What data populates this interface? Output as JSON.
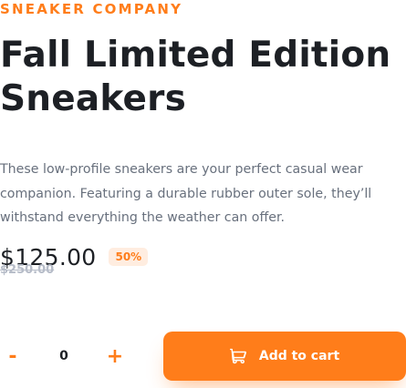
{
  "product": {
    "company": "SNEAKER COMPANY",
    "title": "Fall Limited Edition Sneakers",
    "description": "These low-profile sneakers are your perfect casual wear companion. Featuring a durable rubber outer sole, they’ll withstand everything the weather can offer.",
    "price": "$125.00",
    "discount": "50%",
    "original_price": "$250.00"
  },
  "cart": {
    "decrement_label": "-",
    "quantity": "0",
    "increment_label": "+",
    "add_to_cart_label": "Add to cart",
    "cart_icon": "cart-icon"
  },
  "colors": {
    "accent": "#ff7d1a",
    "accent_pale": "#ffede0",
    "text_dark": "#1d2025",
    "text_gray": "#68707d",
    "text_light": "#b6bcc8"
  }
}
